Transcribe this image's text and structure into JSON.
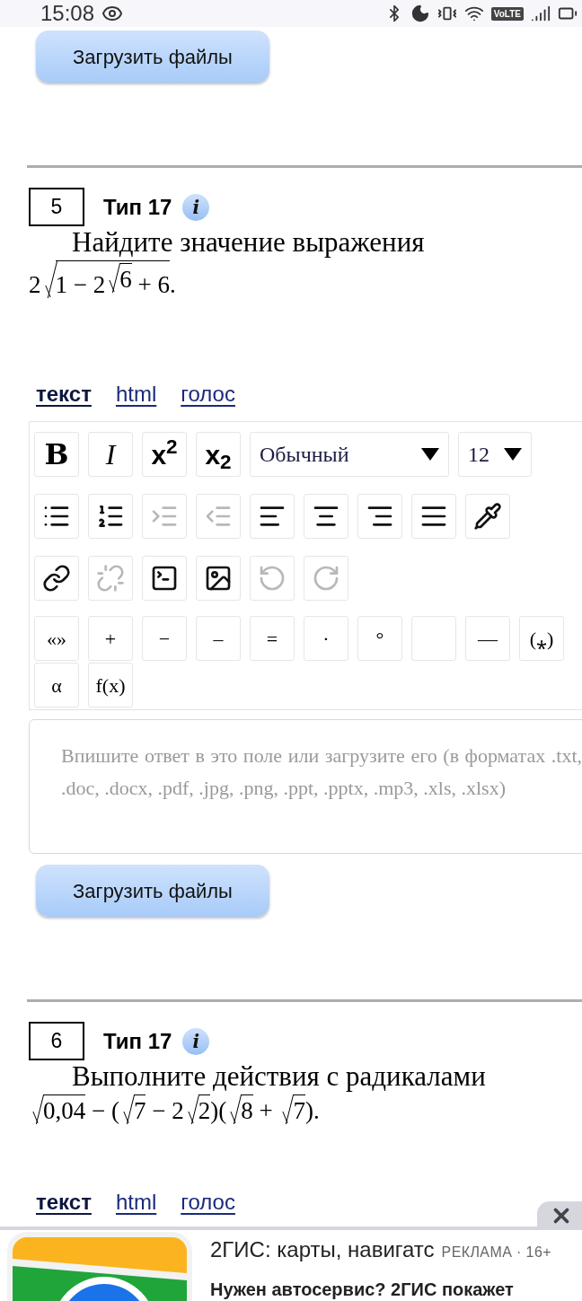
{
  "status_bar": {
    "time": "15:08",
    "network_badge": "VoLTE"
  },
  "top_upload_button": "Загрузить файлы",
  "tasks": [
    {
      "number": "5",
      "type": "Тип 17",
      "info_icon": "i",
      "question": "Найдите значение выражения",
      "formula": [
        {
          "kind": "text",
          "text": "2"
        },
        {
          "kind": "sqrt",
          "children": [
            {
              "kind": "text",
              "text": "1 − 2"
            },
            {
              "kind": "sqrt",
              "children": [
                {
                  "kind": "text",
                  "text": "6"
                }
              ]
            },
            {
              "kind": "text",
              "text": " + 6"
            }
          ]
        },
        {
          "kind": "text",
          "text": "."
        }
      ],
      "answer": {
        "tabs": [
          {
            "label": "текст",
            "selected": true
          },
          {
            "label": "html",
            "selected": false
          },
          {
            "label": "голос",
            "selected": false
          }
        ],
        "format_buttons": [
          "B",
          "I",
          "x$^{2}$",
          "x$_{2}$"
        ],
        "style_select": "Обычный",
        "size_select": "12",
        "icon_rows": [
          [
            {
              "disabled": false
            },
            {
              "disabled": false
            },
            {
              "disabled": true
            },
            {
              "disabled": true
            },
            {
              "disabled": false
            },
            {
              "disabled": false
            },
            {
              "disabled": false
            },
            {
              "disabled": false
            },
            {
              "disabled": false
            }
          ],
          [
            {
              "disabled": false
            },
            {
              "disabled": true
            },
            {
              "disabled": false
            },
            {
              "disabled": false
            },
            {
              "disabled": true
            },
            {
              "disabled": true
            }
          ]
        ],
        "symbols": [
          {
            "kind": "symbol",
            "text": "«»"
          },
          {
            "kind": "symbol",
            "text": "+"
          },
          {
            "kind": "symbol",
            "text": "−"
          },
          {
            "kind": "symbol",
            "text": "–"
          },
          {
            "kind": "symbol",
            "text": "="
          },
          {
            "kind": "symbol",
            "text": "·"
          },
          {
            "kind": "symbol",
            "text": "°"
          },
          {
            "kind": "blank"
          },
          {
            "kind": "symbol",
            "text": "—"
          },
          {
            "kind": "symbol",
            "text": "(⁎)"
          },
          {
            "kind": "symbol",
            "text": "α"
          },
          {
            "kind": "symbol",
            "text": "f(x)"
          }
        ],
        "placeholder": "Впишите ответ в это поле или загрузите его (в форматах .txt, .doc, .docx, .pdf, .jpg, .png, .ppt, .pptx, .mp3, .xls, .xlsx)",
        "upload_button": "Загрузить файлы"
      }
    },
    {
      "number": "6",
      "type": "Тип 17",
      "info_icon": "i",
      "question": "Выполните действия с радикалами",
      "formula": [
        {
          "kind": "sqrt",
          "children": [
            {
              "kind": "text",
              "text": "0,04"
            }
          ]
        },
        {
          "kind": "text",
          "text": " − ("
        },
        {
          "kind": "sqrt",
          "children": [
            {
              "kind": "text",
              "text": "7"
            }
          ]
        },
        {
          "kind": "text",
          "text": " − 2"
        },
        {
          "kind": "sqrt",
          "children": [
            {
              "kind": "text",
              "text": "2"
            }
          ]
        },
        {
          "kind": "text",
          "text": ")("
        },
        {
          "kind": "sqrt",
          "children": [
            {
              "kind": "text",
              "text": "8"
            }
          ]
        },
        {
          "kind": "text",
          "text": " + "
        },
        {
          "kind": "sqrt",
          "children": [
            {
              "kind": "text",
              "text": "7"
            }
          ]
        },
        {
          "kind": "text",
          "text": ")."
        }
      ],
      "answer": {
        "tabs": [
          {
            "label": "текст",
            "selected": true
          },
          {
            "label": "html",
            "selected": false
          },
          {
            "label": "голос",
            "selected": false
          }
        ]
      }
    }
  ],
  "ad": {
    "title": "2ГИС: карты, навигатс",
    "label": "РЕКЛАМА · 16+",
    "text": "Нужен автосервис? 2ГИС покажет"
  }
}
